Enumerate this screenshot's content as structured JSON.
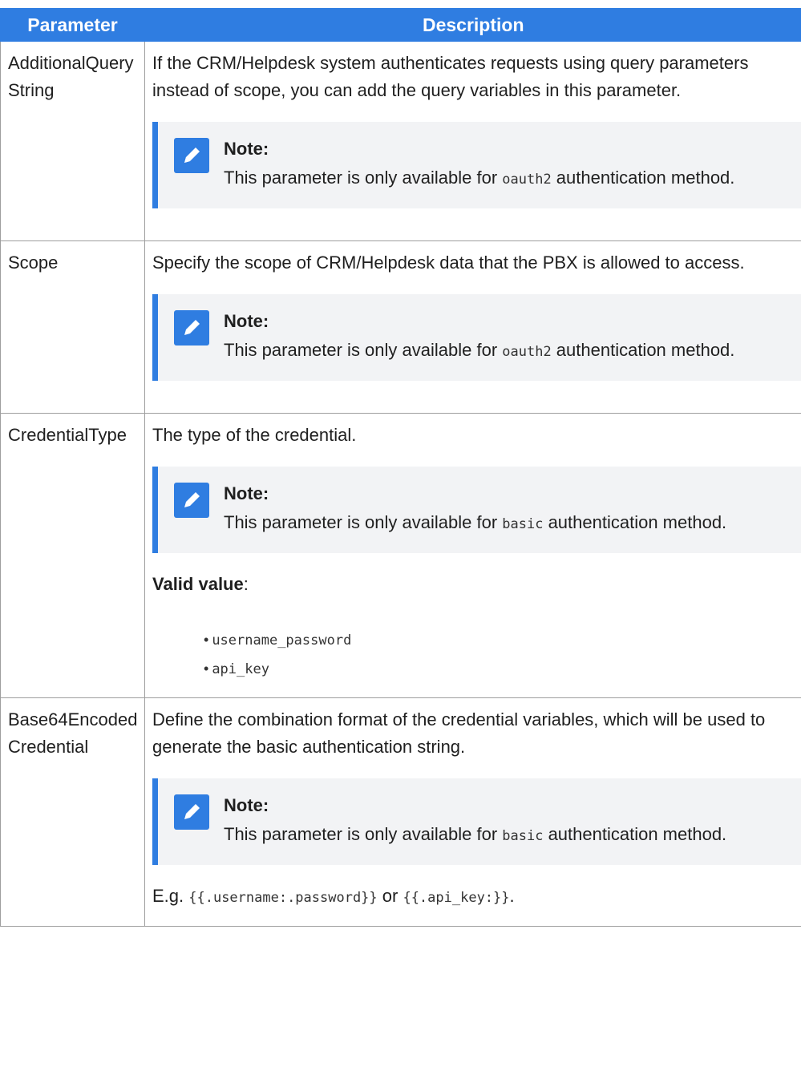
{
  "table": {
    "headers": [
      "Parameter",
      "Description"
    ],
    "rows": [
      {
        "name": "AdditionalQueryString",
        "description": "If the CRM/Helpdesk system authenticates requests using query parameters instead of scope, you can add the query variables in this parameter.",
        "note": {
          "title": "Note:",
          "before": "This parameter is only available for ",
          "code": "oauth2",
          "after": " authentication method."
        }
      },
      {
        "name": "Scope",
        "description": "Specify the scope of CRM/Helpdesk data that the PBX is allowed to access.",
        "note": {
          "title": "Note:",
          "before": "This parameter is only available for ",
          "code": "oauth2",
          "after": " authentication method."
        }
      },
      {
        "name": "CredentialType",
        "description": "The type of the credential.",
        "note": {
          "title": "Note:",
          "before": "This parameter is only available for ",
          "code": "basic",
          "after": " authentication method."
        },
        "valid_label": "Valid value",
        "valid_colon": ":",
        "values": [
          "username_password",
          "api_key"
        ]
      },
      {
        "name": "Base64EncodedCredential",
        "description": "Define the combination format of the credential variables, which will be used to generate the basic authentication string.",
        "note": {
          "title": "Note:",
          "before": "This parameter is only available for ",
          "code": "basic",
          "after": " authentication method."
        },
        "example": {
          "prefix": "E.g. ",
          "code1": "{{.username:.password}}",
          "mid": " or ",
          "code2": "{{.api_key:}}",
          "suffix": "."
        }
      }
    ]
  },
  "icon": "note-pencil-icon",
  "colors": {
    "accent": "#2f7de1",
    "note_bg": "#f2f3f5",
    "border": "#9e9e9e"
  }
}
